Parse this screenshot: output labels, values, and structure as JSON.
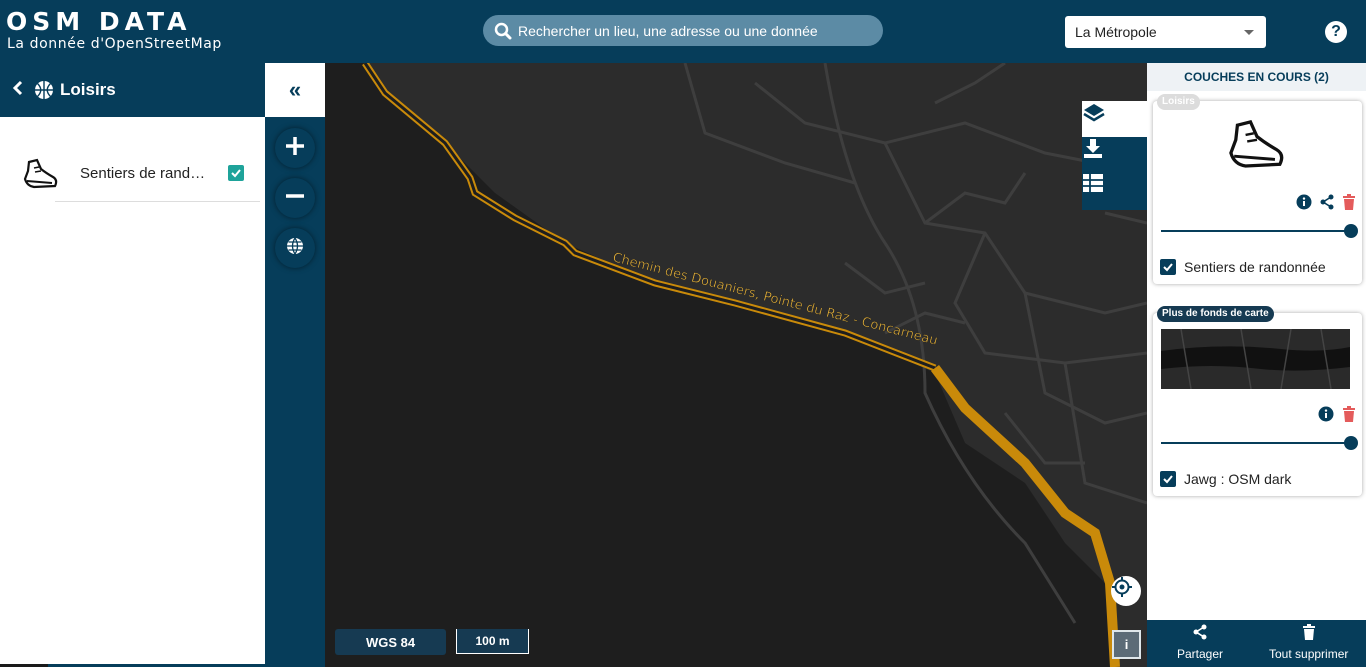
{
  "header": {
    "logo_title": "OSM DATA",
    "logo_subtitle": "La donnée d'OpenStreetMap",
    "search_placeholder": "Rechercher un lieu, une adresse ou une donnée",
    "territory_select": "La Métropole",
    "help_label": "?"
  },
  "left_panel": {
    "back_label": "<",
    "category_title": "Loisirs",
    "category_icon": "basketball-icon",
    "layers": [
      {
        "label": "Sentiers de randonnée",
        "icon": "shoe-icon",
        "checked": true
      }
    ]
  },
  "toolbar": {
    "collapse_label": "«",
    "buttons": [
      "zoom-in-icon",
      "zoom-out-icon",
      "globe-icon"
    ]
  },
  "map": {
    "trail_label": "Chemin des Douaniers, Pointe du Raz - Concarneau",
    "trail_color": "#c98a0a",
    "projection": "WGS 84",
    "scale": "100 m",
    "info_label": "i",
    "tools": [
      "layers-icon",
      "download-icon",
      "table-icon"
    ]
  },
  "right_panel": {
    "title": "COUCHES EN COURS (2)",
    "cards": [
      {
        "tag": "Loisirs",
        "label": "Sentiers de randonnée",
        "checked": true,
        "opacity": 1.0
      },
      {
        "tag": "Plus de fonds de carte",
        "label": "Jawg : OSM dark",
        "checked": true,
        "opacity": 1.0
      }
    ],
    "footer": {
      "share_label": "Partager",
      "delete_all_label": "Tout supprimer"
    }
  },
  "colors": {
    "primary": "#063d5a",
    "accent": "#1ea39a",
    "danger": "#e45b5b"
  }
}
